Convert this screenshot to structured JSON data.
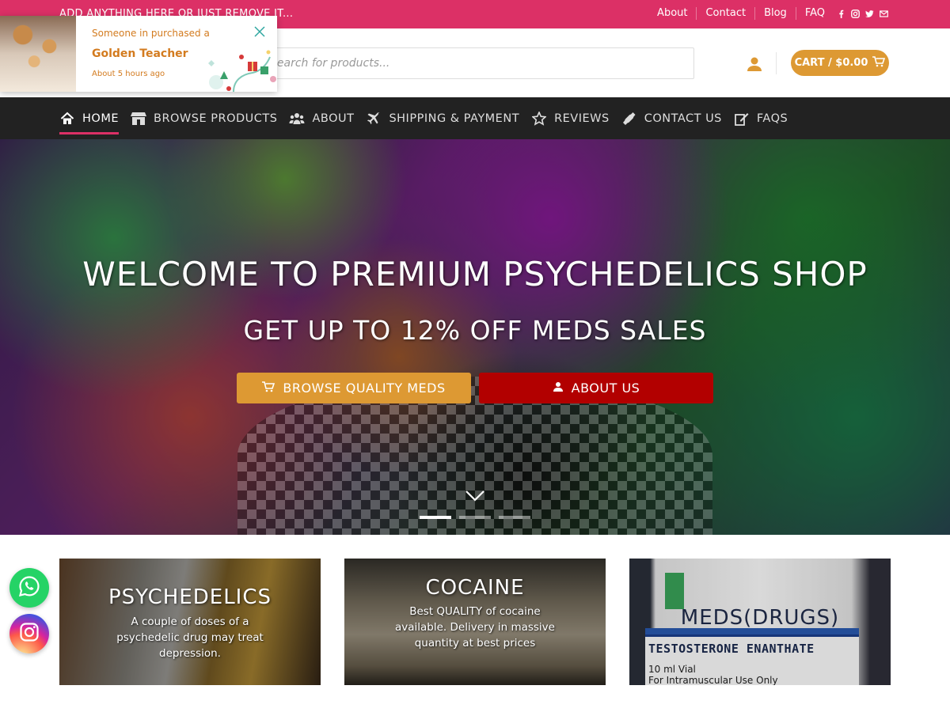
{
  "topbar": {
    "promo": "ADD ANYTHING HERE OR JUST REMOVE IT...",
    "links": [
      "About",
      "Contact",
      "Blog",
      "FAQ"
    ],
    "social_icons": [
      "facebook-icon",
      "instagram-icon",
      "twitter-icon",
      "email-icon"
    ]
  },
  "header": {
    "search_placeholder": "Search for products...",
    "cart_label": "CART / $0.00"
  },
  "nav": {
    "items": [
      {
        "label": "HOME",
        "icon": "home-icon",
        "active": true
      },
      {
        "label": "BROWSE PRODUCTS",
        "icon": "store-icon"
      },
      {
        "label": "ABOUT",
        "icon": "users-icon"
      },
      {
        "label": "SHIPPING & PAYMENT",
        "icon": "plane-icon"
      },
      {
        "label": "REVIEWS",
        "icon": "star-icon"
      },
      {
        "label": "CONTACT US",
        "icon": "phone-icon"
      },
      {
        "label": "FAQS",
        "icon": "edit-icon"
      }
    ]
  },
  "hero": {
    "title": "WELCOME TO PREMIUM PSYCHEDELICS SHOP",
    "subtitle": "GET UP TO 12% OFF MEDS SALES",
    "browse_button": "BROWSE QUALITY MEDS",
    "about_button": "ABOUT US",
    "slides": 3,
    "active_slide": 1
  },
  "categories": [
    {
      "title": "PSYCHEDELICS",
      "description": "A couple of doses of a psychedelic drug may treat depression."
    },
    {
      "title": "COCAINE",
      "description": "Best QUALITY of cocaine available. Delivery in massive quantity at best prices"
    },
    {
      "title": "MEDS(DRUGS)",
      "description": ""
    }
  ],
  "product_image_label": {
    "name": "TESTOSTERONE ENANTHATE",
    "vial": "10 ml Vial",
    "use": "For Intramuscular Use Only"
  },
  "popup": {
    "line1": "Someone in purchased a",
    "product": "Golden Teacher",
    "time": "About 5 hours ago"
  },
  "colors": {
    "topbar": "#dc3066",
    "accent": "#dd9933",
    "nav_bg": "#222222",
    "about_button": "#b20000"
  }
}
